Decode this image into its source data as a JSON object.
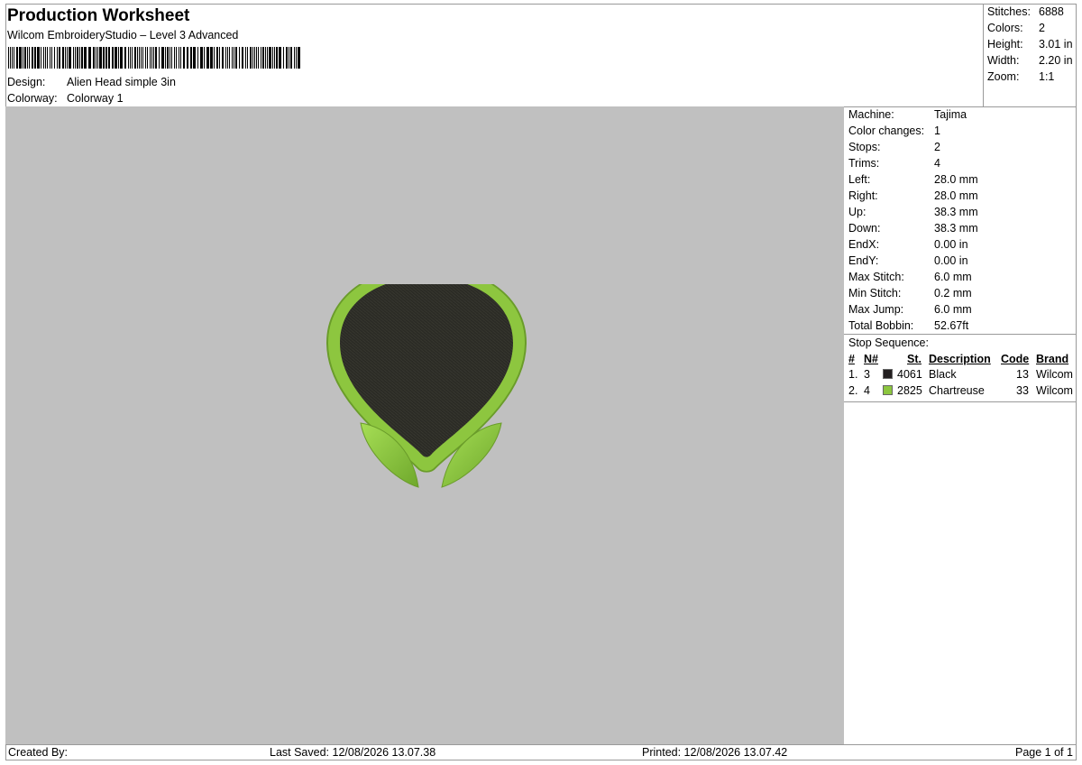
{
  "header": {
    "title": "Production Worksheet",
    "software": "Wilcom EmbroideryStudio – Level 3 Advanced",
    "design_label": "Design:",
    "design_value": "Alien Head simple 3in",
    "colorway_label": "Colorway:",
    "colorway_value": "Colorway 1"
  },
  "summary": [
    {
      "label": "Stitches:",
      "value": "6888"
    },
    {
      "label": "Colors:",
      "value": "2"
    },
    {
      "label": "Height:",
      "value": "3.01 in"
    },
    {
      "label": "Width:",
      "value": "2.20 in"
    },
    {
      "label": "Zoom:",
      "value": "1:1"
    }
  ],
  "machine_info": [
    {
      "label": "Machine:",
      "value": "Tajima"
    },
    {
      "label": "Color changes:",
      "value": "1"
    },
    {
      "label": "Stops:",
      "value": "2"
    },
    {
      "label": "Trims:",
      "value": "4"
    },
    {
      "label": "Left:",
      "value": "28.0 mm"
    },
    {
      "label": "Right:",
      "value": "28.0 mm"
    },
    {
      "label": "Up:",
      "value": "38.3 mm"
    },
    {
      "label": "Down:",
      "value": "38.3 mm"
    },
    {
      "label": "EndX:",
      "value": "0.00 in"
    },
    {
      "label": "EndY:",
      "value": "0.00 in"
    },
    {
      "label": "Max Stitch:",
      "value": "6.0 mm"
    },
    {
      "label": "Min Stitch:",
      "value": "0.2 mm"
    },
    {
      "label": "Max Jump:",
      "value": "6.0 mm"
    },
    {
      "label": "Total Bobbin:",
      "value": "52.67ft"
    }
  ],
  "stop_sequence": {
    "title": "Stop Sequence:",
    "headers": {
      "num": "#",
      "needle": "N#",
      "st": "St.",
      "description": "Description",
      "code": "Code",
      "brand": "Brand"
    },
    "rows": [
      {
        "num": "1.",
        "needle": "3",
        "color": "#231f20",
        "st": "4061",
        "description": "Black",
        "code": "13",
        "brand": "Wilcom"
      },
      {
        "num": "2.",
        "needle": "4",
        "color": "#8cc63f",
        "st": "2825",
        "description": "Chartreuse",
        "code": "33",
        "brand": "Wilcom"
      }
    ]
  },
  "design_colors": {
    "background": "#c0c0c0",
    "outline": "#8dc63f",
    "fill": "#2b2b25"
  },
  "footer": {
    "created_by": "Created By:",
    "last_saved": "Last Saved: 12/08/2026 13.07.38",
    "printed": "Printed: 12/08/2026 13.07.42",
    "page": "Page 1 of 1"
  }
}
